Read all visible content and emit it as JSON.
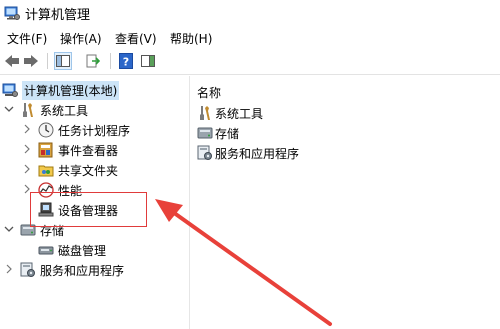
{
  "window": {
    "title": "计算机管理"
  },
  "menu": {
    "items": [
      {
        "label": "文件(F)"
      },
      {
        "label": "操作(A)"
      },
      {
        "label": "查看(V)"
      },
      {
        "label": "帮助(H)"
      }
    ]
  },
  "toolbar": {
    "buttons": [
      "back-icon",
      "forward-icon",
      "show-hide-tree-icon",
      "export-list-icon",
      "help-icon",
      "properties-pane-icon"
    ]
  },
  "tree": {
    "root": {
      "label": "计算机管理(本地)",
      "icon": "computer-management-icon"
    },
    "system_tools": {
      "label": "系统工具",
      "icon": "tools-icon",
      "children": [
        {
          "label": "任务计划程序",
          "icon": "clock-icon"
        },
        {
          "label": "事件查看器",
          "icon": "event-viewer-icon"
        },
        {
          "label": "共享文件夹",
          "icon": "shared-folder-icon"
        },
        {
          "label": "性能",
          "icon": "performance-icon"
        },
        {
          "label": "设备管理器",
          "icon": "device-manager-icon"
        }
      ]
    },
    "storage": {
      "label": "存储",
      "icon": "storage-icon",
      "children": [
        {
          "label": "磁盘管理",
          "icon": "disk-icon"
        }
      ]
    },
    "services": {
      "label": "服务和应用程序",
      "icon": "services-icon"
    }
  },
  "right_pane": {
    "column_header": "名称",
    "items": [
      {
        "label": "系统工具",
        "icon": "tools-icon"
      },
      {
        "label": "存储",
        "icon": "storage-icon"
      },
      {
        "label": "服务和应用程序",
        "icon": "services-icon"
      }
    ]
  },
  "annotation": {
    "highlight_color": "#e03b3b",
    "arrow_color": "#e8413a"
  }
}
